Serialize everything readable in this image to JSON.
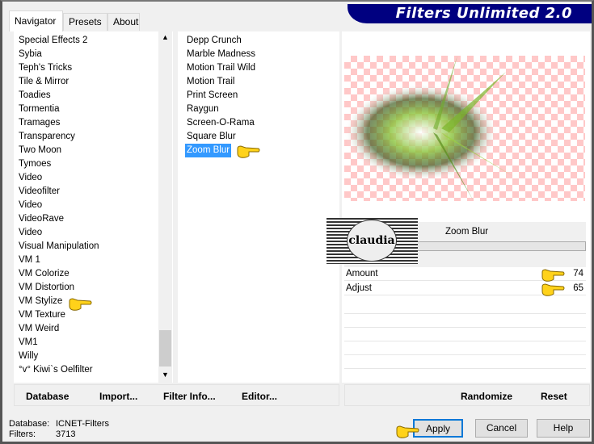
{
  "window": {
    "title": "Filters Unlimited 2.0"
  },
  "tabs": [
    {
      "label": "Navigator",
      "active": true
    },
    {
      "label": "Presets"
    },
    {
      "label": "About"
    }
  ],
  "categories": [
    "Special Effects 2",
    "Sybia",
    "Teph's Tricks",
    "Tile & Mirror",
    "Toadies",
    "Tormentia",
    "Tramages",
    "Transparency",
    "Two Moon",
    "Tymoes",
    "Video",
    "Videofilter",
    "Video",
    "VideoRave",
    "Video",
    "Visual Manipulation",
    "VM 1",
    "VM Colorize",
    "VM Distortion",
    "VM Stylize",
    "VM Texture",
    "VM Weird",
    "VM1",
    "Willy",
    "°v° Kiwi`s Oelfilter"
  ],
  "selected_category": "VM Stylize",
  "filters": [
    "Depp Crunch",
    "Marble Madness",
    "Motion Trail Wild",
    "Motion Trail",
    "Print Screen",
    "Raygun",
    "Screen-O-Rama",
    "Square Blur",
    "Zoom Blur"
  ],
  "selected_filter": "Zoom Blur",
  "filter_name": "Zoom Blur",
  "logo_text": "claudia",
  "params": [
    {
      "label": "Amount",
      "value": "74"
    },
    {
      "label": "Adjust",
      "value": "65"
    }
  ],
  "left_buttons": [
    "Database",
    "Import...",
    "Filter Info...",
    "Editor..."
  ],
  "right_buttons": [
    "Randomize",
    "Reset"
  ],
  "status": {
    "database_label": "Database:",
    "database_value": "ICNET-Filters",
    "filters_label": "Filters:",
    "filters_value": "3713"
  },
  "dialog_buttons": {
    "apply": "Apply",
    "cancel": "Cancel",
    "help": "Help"
  },
  "colors": {
    "banner": "#000080",
    "selection": "#3399ff",
    "checker": "#ffc8c8"
  }
}
